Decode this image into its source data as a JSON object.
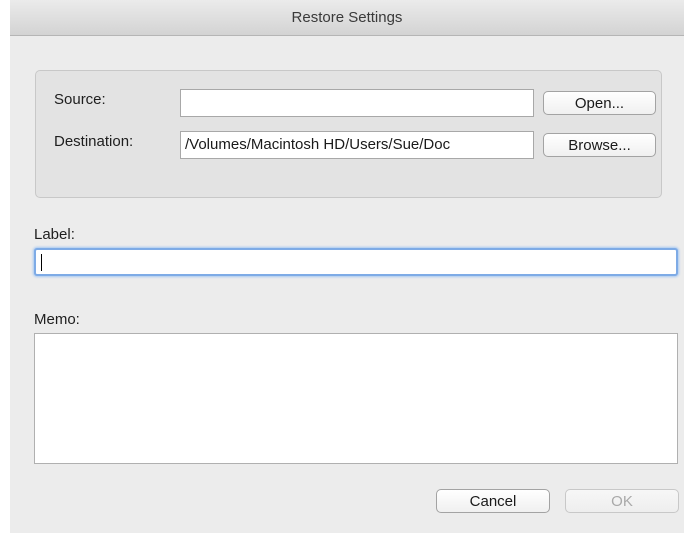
{
  "window": {
    "title": "Restore Settings"
  },
  "source": {
    "label": "Source:",
    "value": "",
    "button": "Open..."
  },
  "destination": {
    "label": "Destination:",
    "value": "/Volumes/Macintosh HD/Users/Sue/Doc",
    "button": "Browse..."
  },
  "label_field": {
    "label": "Label:",
    "value": ""
  },
  "memo": {
    "label": "Memo:",
    "value": ""
  },
  "buttons": {
    "cancel": "Cancel",
    "ok": "OK"
  }
}
